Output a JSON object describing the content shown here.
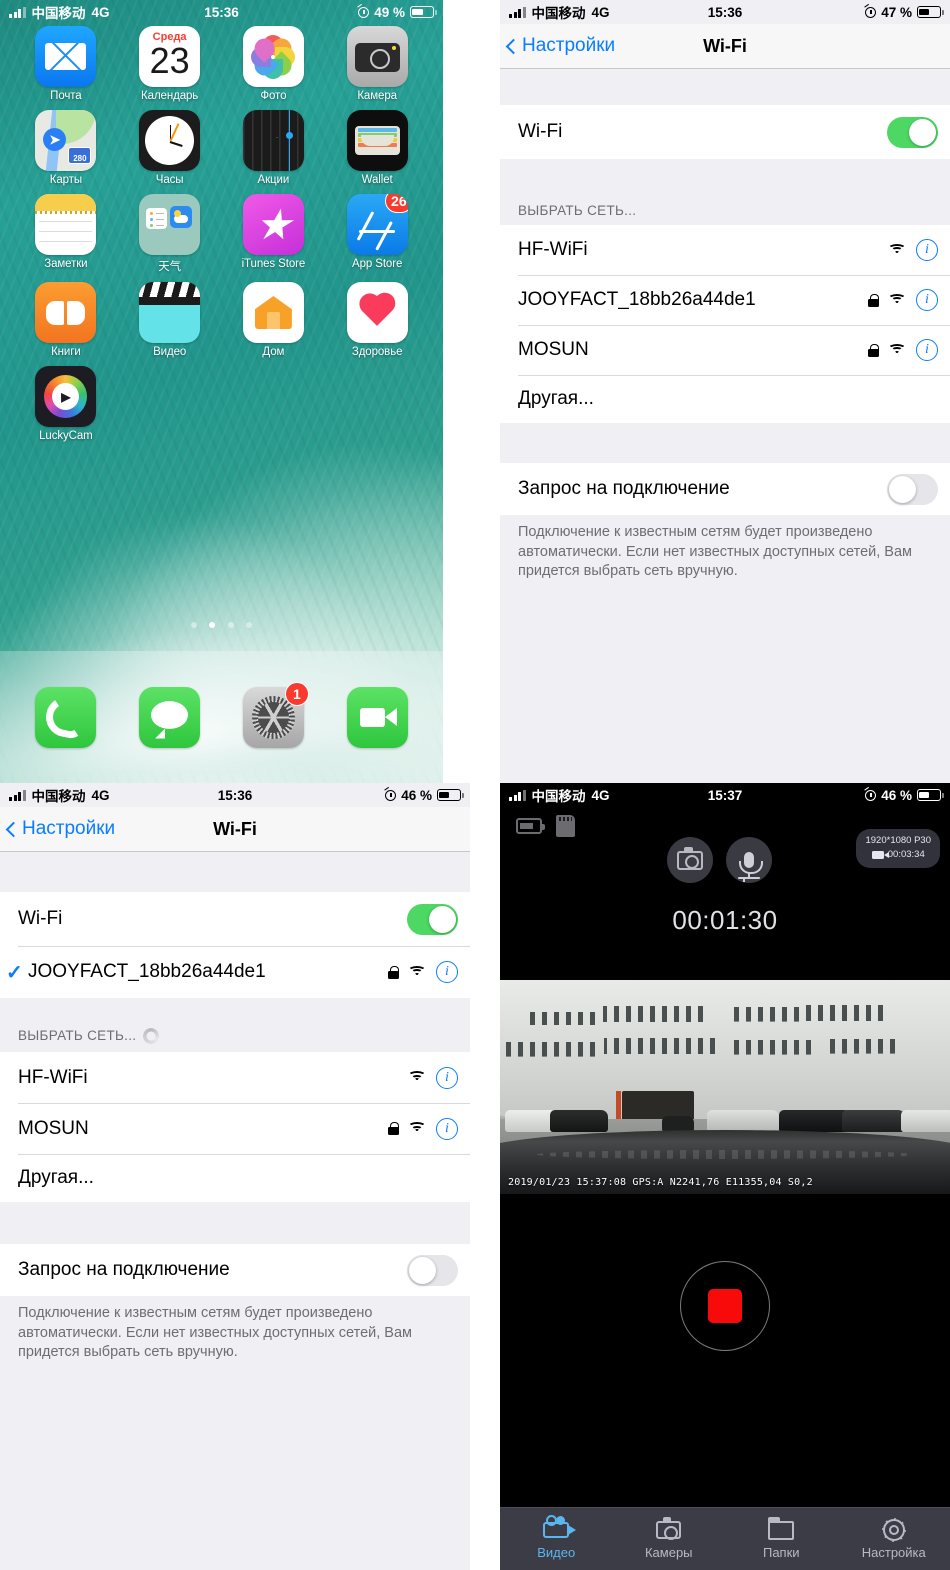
{
  "home": {
    "status": {
      "carrier": "中国移动",
      "network": "4G",
      "time": "15:36",
      "battery": "49 %",
      "battery_level": 49
    },
    "apps": [
      {
        "label": "Почта",
        "icon": "mail-icon"
      },
      {
        "label": "Календарь",
        "icon": "calendar-icon",
        "weekday": "Среда",
        "day": "23"
      },
      {
        "label": "Фото",
        "icon": "photos-icon"
      },
      {
        "label": "Камера",
        "icon": "camera-icon"
      },
      {
        "label": "Карты",
        "icon": "maps-icon",
        "route": "280"
      },
      {
        "label": "Часы",
        "icon": "clock-icon"
      },
      {
        "label": "Акции",
        "icon": "stocks-icon"
      },
      {
        "label": "Wallet",
        "icon": "wallet-icon"
      },
      {
        "label": "Заметки",
        "icon": "notes-icon"
      },
      {
        "label": "天气",
        "icon": "weather-icon"
      },
      {
        "label": "iTunes Store",
        "icon": "itunes-store-icon"
      },
      {
        "label": "App Store",
        "icon": "app-store-icon",
        "badge": "26"
      },
      {
        "label": "Книги",
        "icon": "books-icon"
      },
      {
        "label": "Видео",
        "icon": "videos-icon"
      },
      {
        "label": "Дом",
        "icon": "home-app-icon"
      },
      {
        "label": "Здоровье",
        "icon": "health-icon"
      },
      {
        "label": "LuckyCam",
        "icon": "luckycam-icon"
      }
    ],
    "pages": {
      "count": 4,
      "active": 2
    },
    "dock": [
      {
        "label": "Телефон",
        "icon": "phone-icon"
      },
      {
        "label": "Сообщения",
        "icon": "messages-icon"
      },
      {
        "label": "Настройки",
        "icon": "settings-gear-icon",
        "badge": "1"
      },
      {
        "label": "FaceTime",
        "icon": "facetime-icon"
      }
    ]
  },
  "wifi_a": {
    "status": {
      "carrier": "中国移动",
      "network": "4G",
      "time": "15:36",
      "battery": "47 %",
      "battery_level": 47
    },
    "nav": {
      "back": "Настройки",
      "title": "Wi-Fi"
    },
    "toggle_label": "Wi-Fi",
    "toggle_state": "on",
    "section_header": "ВЫБРАТЬ СЕТЬ...",
    "networks": [
      {
        "ssid": "HF-WiFi",
        "secured": false,
        "connected": false
      },
      {
        "ssid": "JOOYFACT_18bb26a44de1",
        "secured": true,
        "connected": false
      },
      {
        "ssid": "MOSUN",
        "secured": true,
        "connected": false
      }
    ],
    "other": "Другая...",
    "ask_label": "Запрос на подключение",
    "ask_state": "off",
    "footer": "Подключение к известным сетям будет произведено автоматически. Если нет известных доступных сетей, Вам придется выбрать сеть вручную."
  },
  "wifi_b": {
    "status": {
      "carrier": "中国移动",
      "network": "4G",
      "time": "15:36",
      "battery": "46 %",
      "battery_level": 46
    },
    "nav": {
      "back": "Настройки",
      "title": "Wi-Fi"
    },
    "toggle_label": "Wi-Fi",
    "toggle_state": "on",
    "connected": {
      "ssid": "JOOYFACT_18bb26a44de1",
      "secured": true,
      "connected": true
    },
    "section_header": "ВЫБРАТЬ СЕТЬ...",
    "scanning": true,
    "networks": [
      {
        "ssid": "HF-WiFi",
        "secured": false,
        "connected": false
      },
      {
        "ssid": "MOSUN",
        "secured": true,
        "connected": false
      }
    ],
    "other": "Другая...",
    "ask_label": "Запрос на подключение",
    "ask_state": "off",
    "footer": "Подключение к известным сетям будет произведено автоматически. Если нет известных доступных сетей, Вам придется выбрать сеть вручную."
  },
  "dashcam": {
    "status": {
      "carrier": "中国移动",
      "network": "4G",
      "time": "15:37",
      "battery": "46 %",
      "battery_level": 46
    },
    "indicators": [
      {
        "name": "battery-charging-icon"
      },
      {
        "name": "sd-card-icon"
      }
    ],
    "controls": [
      {
        "name": "snapshot-button",
        "icon": "camera-icon"
      },
      {
        "name": "microphone-button",
        "icon": "microphone-icon"
      }
    ],
    "resolution": "1920*1080 P30",
    "clip_length": "00:03:34",
    "timer": "00:01:30",
    "osd": "2019/01/23 15:37:08 GPS:A N2241,76 E11355,04 S0,2",
    "record_button": {
      "name": "stop-record-button",
      "state": "recording",
      "color": "#f80a0a"
    },
    "tabs": [
      {
        "label": "Видео",
        "icon": "video-camera-icon",
        "active": true
      },
      {
        "label": "Камеры",
        "icon": "camera-icon",
        "active": false
      },
      {
        "label": "Папки",
        "icon": "folder-icon",
        "active": false
      },
      {
        "label": "Настройка",
        "icon": "gear-icon",
        "active": false
      }
    ]
  }
}
